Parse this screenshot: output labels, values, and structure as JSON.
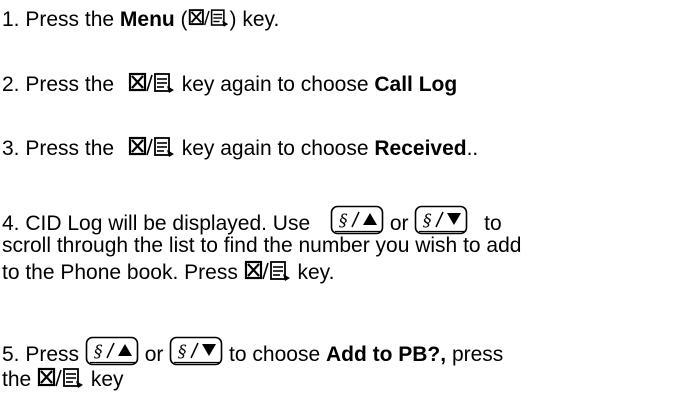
{
  "icons": {
    "menu_key": "menu-phonebook-key-icon",
    "up_key": "phone-up-arrow-key-icon",
    "down_key": "phone-down-arrow-key-icon"
  },
  "steps": {
    "s1": {
      "a": "1. Press the ",
      "b": "Menu",
      "c": " (",
      "d": ") key."
    },
    "s2": {
      "a": "2. Press the ",
      "b": " key again to choose ",
      "c": "Call Log"
    },
    "s3": {
      "a": "3. Press the ",
      "b": " key again to choose ",
      "c": "Received",
      "d": ".."
    },
    "s4": {
      "a": "4. CID Log will be displayed.   Use ",
      "b": " or ",
      "c": " to",
      "line2": "scroll through the list to find the number you wish to add",
      "line3a": "to the Phone book. Press ",
      "line3b": " key."
    },
    "s5": {
      "a": "5. Press ",
      "b": " or ",
      "c": " to choose ",
      "d": "Add to PB?,",
      "e": " press",
      "line2a": "the ",
      "line2b": " key"
    }
  }
}
